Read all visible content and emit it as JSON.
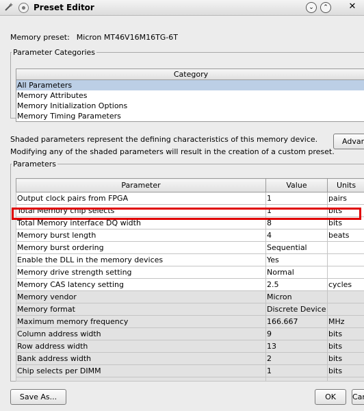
{
  "window": {
    "title": "Preset Editor",
    "icons": [
      "wand-icon",
      "menu-icon",
      "minimize-icon",
      "maximize-icon",
      "close-icon"
    ],
    "min_glyph": "⌄",
    "max_glyph": "⌃",
    "close_glyph": "✕"
  },
  "preset": {
    "label": "Memory preset:",
    "value": "Micron MT46V16M16TG-6T"
  },
  "categories": {
    "legend": "Parameter Categories",
    "header": "Category",
    "items": [
      {
        "label": "All Parameters",
        "selected": true
      },
      {
        "label": "Memory Attributes",
        "selected": false
      },
      {
        "label": "Memory Initialization Options",
        "selected": false
      },
      {
        "label": "Memory Timing Parameters",
        "selected": false
      }
    ]
  },
  "description": {
    "line1": "Shaded parameters represent the defining characteristics of this memory device.",
    "line2": "Modifying any of the shaded parameters will result in the creation of a custom preset.",
    "advanced_button": "Advanced..."
  },
  "parameters": {
    "legend": "Parameters",
    "columns": [
      "Parameter",
      "Value",
      "Units"
    ],
    "rows": [
      {
        "name": "Output clock pairs from FPGA",
        "value": "1",
        "units": "pairs",
        "shaded": false
      },
      {
        "name": "Total Memory chip selects",
        "value": "1",
        "units": "bits",
        "shaded": false
      },
      {
        "name": "Total Memory interface DQ width",
        "value": "8",
        "units": "bits",
        "shaded": false,
        "highlighted": true
      },
      {
        "name": "Memory burst length",
        "value": "4",
        "units": "beats",
        "shaded": false
      },
      {
        "name": "Memory burst ordering",
        "value": "Sequential",
        "units": "",
        "shaded": false
      },
      {
        "name": "Enable the DLL in the memory devices",
        "value": "Yes",
        "units": "",
        "shaded": false
      },
      {
        "name": "Memory drive strength setting",
        "value": "Normal",
        "units": "",
        "shaded": false
      },
      {
        "name": "Memory CAS latency setting",
        "value": "2.5",
        "units": "cycles",
        "shaded": false
      },
      {
        "name": "Memory vendor",
        "value": "Micron",
        "units": "",
        "shaded": true
      },
      {
        "name": "Memory format",
        "value": "Discrete Device",
        "units": "",
        "shaded": true
      },
      {
        "name": "Maximum memory frequency",
        "value": "166.667",
        "units": "MHz",
        "shaded": true
      },
      {
        "name": "Column address width",
        "value": "9",
        "units": "bits",
        "shaded": true
      },
      {
        "name": "Row address width",
        "value": "13",
        "units": "bits",
        "shaded": true
      },
      {
        "name": "Bank address width",
        "value": "2",
        "units": "bits",
        "shaded": true
      },
      {
        "name": "Chip selects per DIMM",
        "value": "1",
        "units": "bits",
        "shaded": true
      }
    ]
  },
  "buttons": {
    "save_as": "Save As...",
    "ok": "OK",
    "cancel": "Cancel"
  },
  "colors": {
    "selection": "#bccfe6",
    "shaded_row": "#e2e2e2",
    "highlight_box": "#e00000"
  }
}
